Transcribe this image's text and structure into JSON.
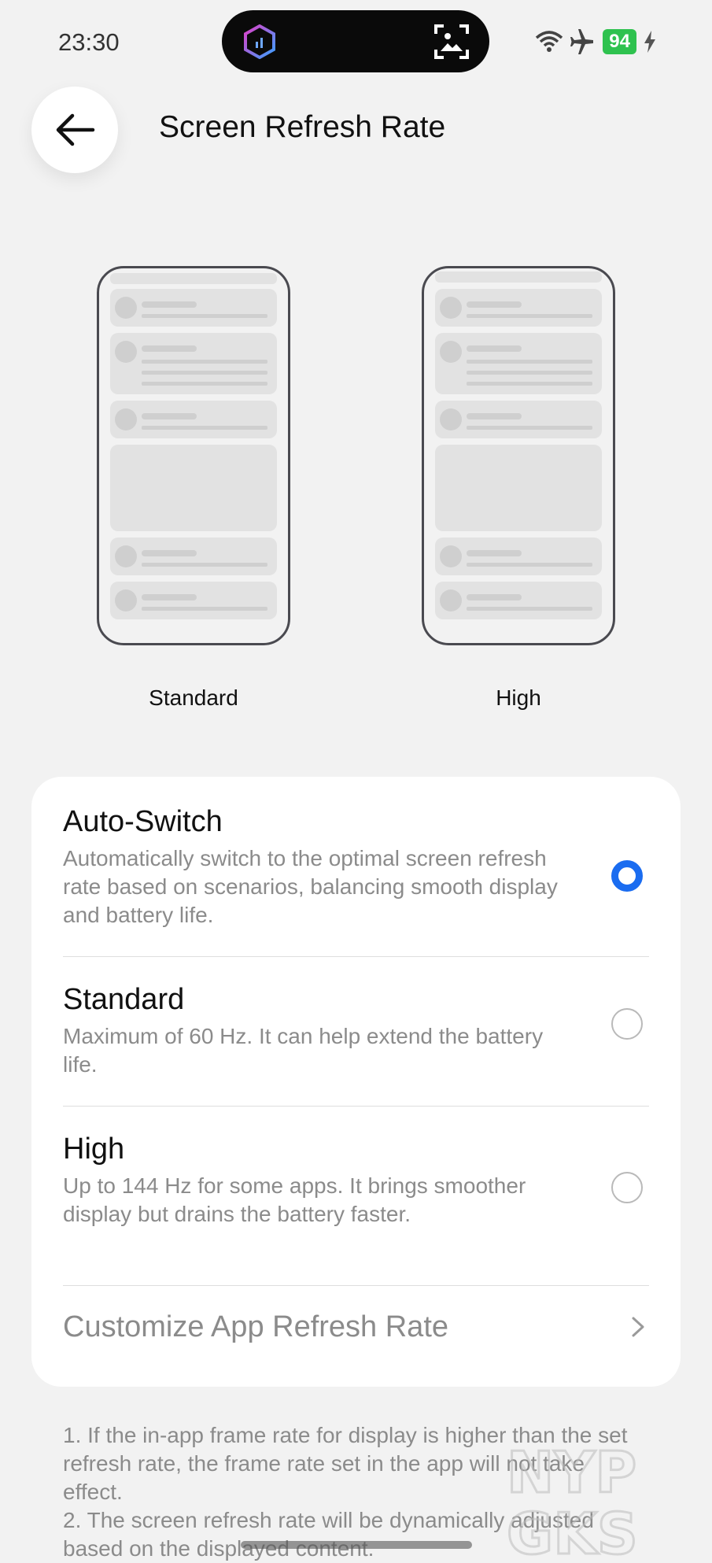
{
  "status_bar": {
    "time": "23:30",
    "battery_level": "94",
    "icons": [
      "island-app-icon",
      "screen-scan-icon",
      "wifi-icon",
      "airplane-icon",
      "battery-icon",
      "charging-icon"
    ],
    "battery_color": "#2fc24f"
  },
  "header": {
    "back_icon": "arrow-left-icon",
    "title": "Screen Refresh Rate"
  },
  "previews": [
    {
      "label": "Standard"
    },
    {
      "label": "High"
    }
  ],
  "options": [
    {
      "title": "Auto-Switch",
      "description": "Automatically switch to the optimal screen refresh rate based on scenarios, balancing smooth display and battery life.",
      "selected": true
    },
    {
      "title": "Standard",
      "description": "Maximum of 60 Hz. It can help extend the battery life.",
      "selected": false
    },
    {
      "title": "High",
      "description": "Up to 144 Hz for some apps. It brings smoother display but drains the battery faster.",
      "selected": false
    }
  ],
  "customize": {
    "label": "Customize App Refresh Rate",
    "icon": "chevron-right-icon"
  },
  "notes": [
    "1. If the in-app frame rate for display is higher than the set refresh rate, the frame rate set in the app will not take effect.",
    "2. The screen refresh rate will be dynamically adjusted based on the displayed content."
  ],
  "watermark": {
    "text_line1": "NYP",
    "text_line2": "GKS"
  },
  "colors": {
    "accent": "#1a6cf0",
    "background": "#f2f2f2",
    "card": "#ffffff",
    "secondary_text": "#8b8b8b"
  }
}
